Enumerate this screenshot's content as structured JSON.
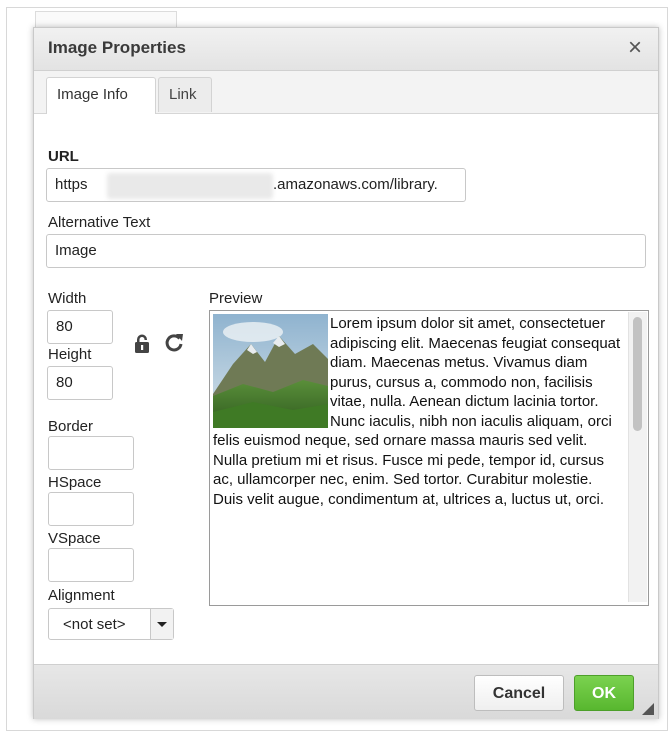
{
  "dialog": {
    "title": "Image Properties",
    "close_glyph": "×",
    "tabs": [
      {
        "label": "Image Info",
        "active": true
      },
      {
        "label": "Link",
        "active": false
      }
    ]
  },
  "form": {
    "url_label": "URL",
    "url_prefix": "https",
    "url_suffix": ".amazonaws.com/library.",
    "alt_label": "Alternative Text",
    "alt_value": "Image",
    "width_label": "Width",
    "width_value": "80",
    "height_label": "Height",
    "height_value": "80",
    "border_label": "Border",
    "border_value": "",
    "hspace_label": "HSpace",
    "hspace_value": "",
    "vspace_label": "VSpace",
    "vspace_value": "",
    "alignment_label": "Alignment",
    "alignment_value": "<not set>",
    "icons": {
      "lock": "lock-icon",
      "reset": "reset-size-icon"
    }
  },
  "preview": {
    "label": "Preview",
    "text": "Lorem ipsum dolor sit amet, consectetuer adipiscing elit. Maecenas feugiat consequat diam. Maecenas metus. Vivamus diam purus, cursus a, commodo non, facilisis vitae, nulla. Aenean dictum lacinia tortor. Nunc iaculis, nibh non iaculis aliquam, orci felis euismod neque, sed ornare massa mauris sed velit. Nulla pretium mi et risus. Fusce mi pede, tempor id, cursus ac, ullamcorper nec, enim. Sed tortor. Curabitur molestie. Duis velit augue, condimentum at, ultrices a, luctus ut, orci."
  },
  "footer": {
    "cancel_label": "Cancel",
    "ok_label": "OK"
  },
  "colors": {
    "ok_button": "#5cb833",
    "titlebar": "#e8e8e8"
  }
}
